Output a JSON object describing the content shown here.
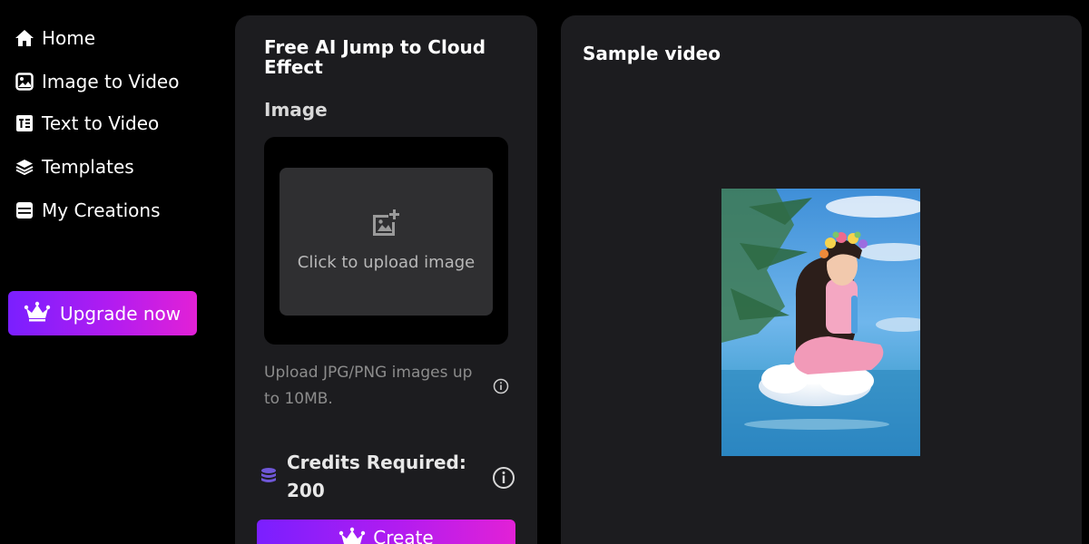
{
  "sidebar": {
    "items": [
      {
        "label": "Home",
        "icon": "home-icon"
      },
      {
        "label": "Image to Video",
        "icon": "image-icon"
      },
      {
        "label": "Text to Video",
        "icon": "text-to-video-icon"
      },
      {
        "label": "Templates",
        "icon": "layers-icon"
      },
      {
        "label": "My Creations",
        "icon": "archive-icon"
      }
    ],
    "upgrade_label": "Upgrade now"
  },
  "form": {
    "title": "Free AI Jump to Cloud Effect",
    "image_label": "Image",
    "upload_label": "Click to upload image",
    "upload_hint": "Upload JPG/PNG images up to 10MB.",
    "credits_label": "Credits Required: 200",
    "create_label": "Create"
  },
  "preview": {
    "title": "Sample video"
  },
  "colors": {
    "accent_start": "#7a1fff",
    "accent_end": "#e221d6",
    "panel_bg": "#1c1c1f",
    "page_bg": "#000000"
  }
}
